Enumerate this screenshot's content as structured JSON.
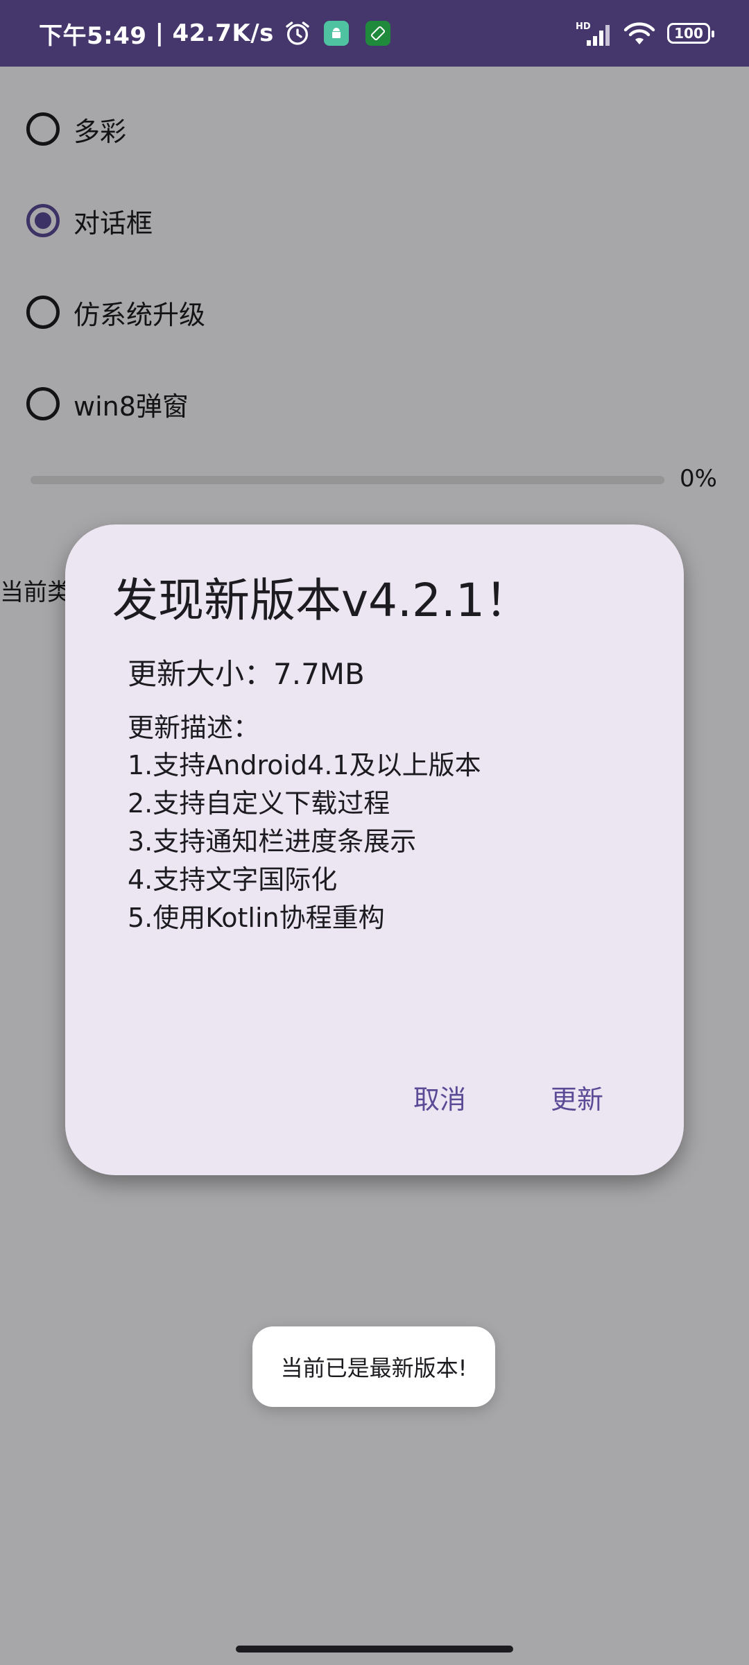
{
  "status_bar": {
    "time": "下午5:49",
    "separator": "|",
    "network_speed": "42.7K/s",
    "network_type": "HD",
    "battery_level": "100",
    "icons": [
      "alarm-icon",
      "android-app-icon",
      "rotate-app-icon",
      "signal-icon",
      "wifi-icon",
      "battery-icon"
    ]
  },
  "options": {
    "items": [
      {
        "label": "多彩",
        "checked": false
      },
      {
        "label": "对话框",
        "checked": true
      },
      {
        "label": "仿系统升级",
        "checked": false
      },
      {
        "label": "win8弹窗",
        "checked": false
      }
    ]
  },
  "progress": {
    "value": 0,
    "label": "0%"
  },
  "current_label": "当前类",
  "dialog": {
    "title": "发现新版本v4.2.1！",
    "size_text": "更新大小：7.7MB",
    "desc_title": "更新描述：",
    "desc_items": [
      "1.支持Android4.1及以上版本",
      "2.支持自定义下载过程",
      "3.支持通知栏进度条展示",
      "4.支持文字国际化",
      "5.使用Kotlin协程重构"
    ],
    "cancel_label": "取消",
    "update_label": "更新"
  },
  "toast": {
    "text": "当前已是最新版本!"
  },
  "colors": {
    "status_bar": "#45376c",
    "accent": "#5b4a95",
    "dialog_bg": "#ece6f3"
  }
}
